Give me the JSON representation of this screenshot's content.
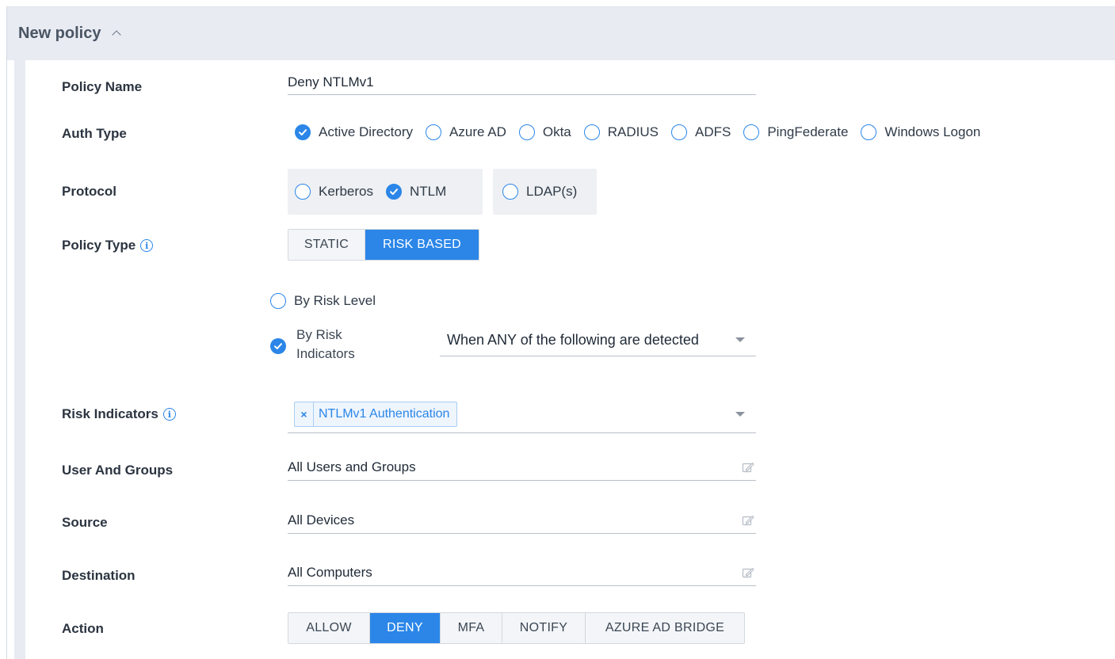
{
  "header": {
    "title": "New policy"
  },
  "policy_name": {
    "label": "Policy Name",
    "value": "Deny NTLMv1"
  },
  "auth_type": {
    "label": "Auth Type",
    "options": [
      {
        "label": "Active Directory",
        "checked": true
      },
      {
        "label": "Azure AD",
        "checked": false
      },
      {
        "label": "Okta",
        "checked": false
      },
      {
        "label": "RADIUS",
        "checked": false
      },
      {
        "label": "ADFS",
        "checked": false
      },
      {
        "label": "PingFederate",
        "checked": false
      },
      {
        "label": "Windows Logon",
        "checked": false
      }
    ]
  },
  "protocol": {
    "label": "Protocol",
    "options": [
      {
        "label": "Kerberos",
        "checked": false
      },
      {
        "label": "NTLM",
        "checked": true
      },
      {
        "label": "LDAP(s)",
        "checked": false
      }
    ]
  },
  "policy_type": {
    "label": "Policy Type",
    "options": [
      {
        "label": "STATIC",
        "active": false
      },
      {
        "label": "RISK BASED",
        "active": true
      }
    ]
  },
  "risk_mode": {
    "by_level": {
      "label": "By Risk Level",
      "checked": false
    },
    "by_indicators": {
      "label": "By Risk Indicators",
      "checked": true
    },
    "condition": "When ANY of the following are detected"
  },
  "risk_indicators": {
    "label": "Risk Indicators",
    "tags": [
      "NTLMv1 Authentication"
    ],
    "remove_symbol": "×"
  },
  "users_groups": {
    "label": "User And Groups",
    "value": "All Users and Groups"
  },
  "source": {
    "label": "Source",
    "value": "All Devices"
  },
  "destination": {
    "label": "Destination",
    "value": "All Computers"
  },
  "action": {
    "label": "Action",
    "options": [
      {
        "label": "ALLOW",
        "active": false
      },
      {
        "label": "DENY",
        "active": true
      },
      {
        "label": "MFA",
        "active": false
      },
      {
        "label": "NOTIFY",
        "active": false
      },
      {
        "label": "AZURE AD BRIDGE",
        "active": false
      }
    ]
  },
  "icons": {
    "collapse": "chevron-up-icon",
    "info": "info-icon",
    "edit": "edit-icon",
    "check": "checkmark-icon",
    "dropdown": "caret-down-icon"
  },
  "colors": {
    "accent": "#2b86e8",
    "header_bg": "#e8ebf2",
    "group_bg": "#eef0f3"
  }
}
